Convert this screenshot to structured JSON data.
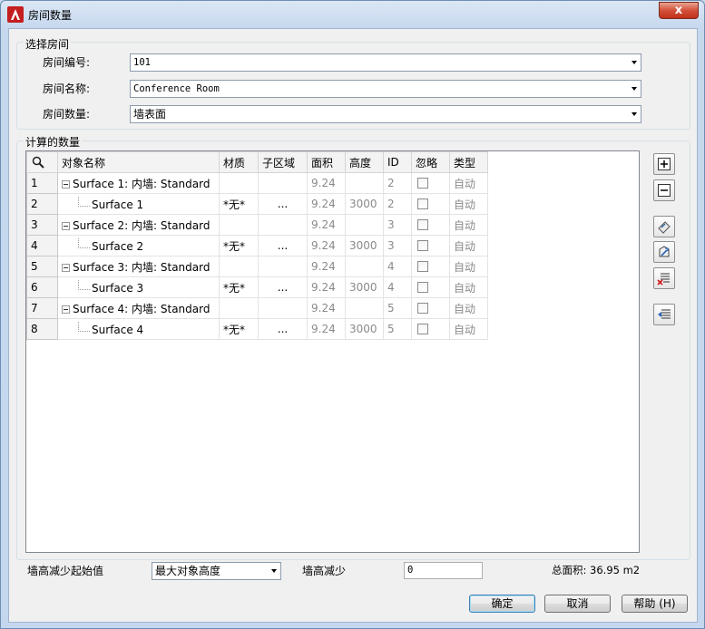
{
  "window": {
    "title": "房间数量",
    "close_label": "x"
  },
  "select_group": {
    "label": "选择房间",
    "room_number_label": "房间编号:",
    "room_number_value": "101",
    "room_name_label": "房间名称:",
    "room_name_value": "Conference Room",
    "room_count_label": "房间数量:",
    "room_count_value": "墙表面"
  },
  "calc_group": {
    "label": "计算的数量"
  },
  "table": {
    "headers": [
      "对象名称",
      "材质",
      "子区域",
      "面积",
      "高度",
      "ID",
      "忽略",
      "类型"
    ],
    "rows": [
      {
        "num": "1",
        "name": "Surface 1: 内墙: Standard",
        "material": "",
        "sub": "",
        "area": "9.24",
        "height": "",
        "id": "2",
        "type": "自动"
      },
      {
        "num": "2",
        "name": "Surface 1",
        "material": "*无*",
        "sub": "...",
        "area": "9.24",
        "height": "3000",
        "id": "2",
        "type": "自动"
      },
      {
        "num": "3",
        "name": "Surface 2: 内墙: Standard",
        "material": "",
        "sub": "",
        "area": "9.24",
        "height": "",
        "id": "3",
        "type": "自动"
      },
      {
        "num": "4",
        "name": "Surface 2",
        "material": "*无*",
        "sub": "...",
        "area": "9.24",
        "height": "3000",
        "id": "3",
        "type": "自动"
      },
      {
        "num": "5",
        "name": "Surface 3: 内墙: Standard",
        "material": "",
        "sub": "",
        "area": "9.24",
        "height": "",
        "id": "4",
        "type": "自动"
      },
      {
        "num": "6",
        "name": "Surface 3",
        "material": "*无*",
        "sub": "...",
        "area": "9.24",
        "height": "3000",
        "id": "4",
        "type": "自动"
      },
      {
        "num": "7",
        "name": "Surface 4: 内墙: Standard",
        "material": "",
        "sub": "",
        "area": "9.24",
        "height": "",
        "id": "5",
        "type": "自动"
      },
      {
        "num": "8",
        "name": "Surface 4",
        "material": "*无*",
        "sub": "...",
        "area": "9.24",
        "height": "3000",
        "id": "5",
        "type": "自动"
      }
    ]
  },
  "bottom": {
    "wall_reduce_start_label": "墙高减少起始值",
    "wall_reduce_start_value": "最大对象高度",
    "wall_reduce_label": "墙高减少",
    "wall_reduce_value": "0",
    "total_area_label": "总面积: 36.95 m2"
  },
  "buttons": {
    "ok": "确定",
    "cancel": "取消",
    "help": "帮助 (H)"
  },
  "icons": [
    "autocad-app-icon",
    "search-icon",
    "expand-all-icon",
    "collapse-all-icon",
    "add-surface-icon",
    "edit-surface-icon",
    "delete-surface-icon",
    "import-icon"
  ]
}
